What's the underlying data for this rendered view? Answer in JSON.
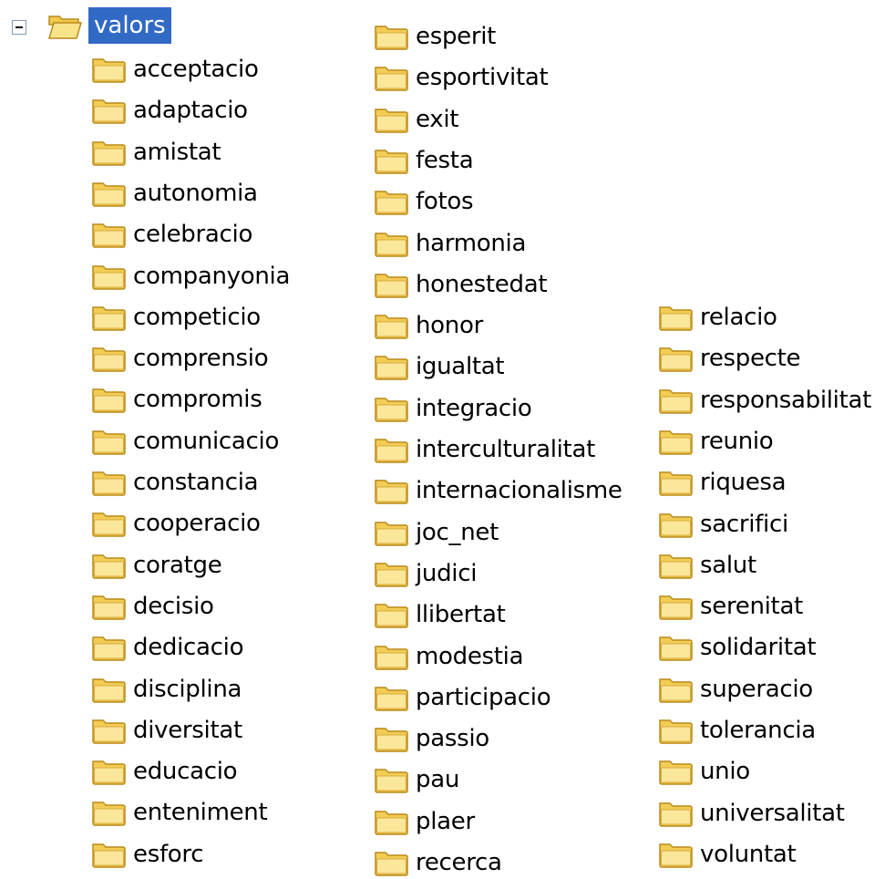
{
  "tree": {
    "root": {
      "label": "valors",
      "expanded": true,
      "selected": true,
      "icon": "folder-open-icon"
    },
    "columns": [
      {
        "items": [
          "acceptacio",
          "adaptacio",
          "amistat",
          "autonomia",
          "celebracio",
          "companyonia",
          "competicio",
          "comprensio",
          "compromis",
          "comunicacio",
          "constancia",
          "cooperacio",
          "coratge",
          "decisio",
          "dedicacio",
          "disciplina",
          "diversitat",
          "educacio",
          "enteniment",
          "esforc"
        ]
      },
      {
        "items": [
          "esperit",
          "esportivitat",
          "exit",
          "festa",
          "fotos",
          "harmonia",
          "honestedat",
          "honor",
          "igualtat",
          "integracio",
          "interculturalitat",
          "internacionalisme",
          "joc_net",
          "judici",
          "llibertat",
          "modestia",
          "participacio",
          "passio",
          "pau",
          "plaer",
          "recerca"
        ]
      },
      {
        "items": [
          "relacio",
          "respecte",
          "responsabilitat",
          "reunio",
          "riquesa",
          "sacrifici",
          "salut",
          "serenitat",
          "solidaritat",
          "superacio",
          "tolerancia",
          "unio",
          "universalitat",
          "voluntat"
        ]
      }
    ],
    "icon": "folder-icon",
    "colors": {
      "selection": "#316ac5",
      "folder_fill": "#f5d462",
      "folder_outline": "#b98a1a"
    }
  }
}
